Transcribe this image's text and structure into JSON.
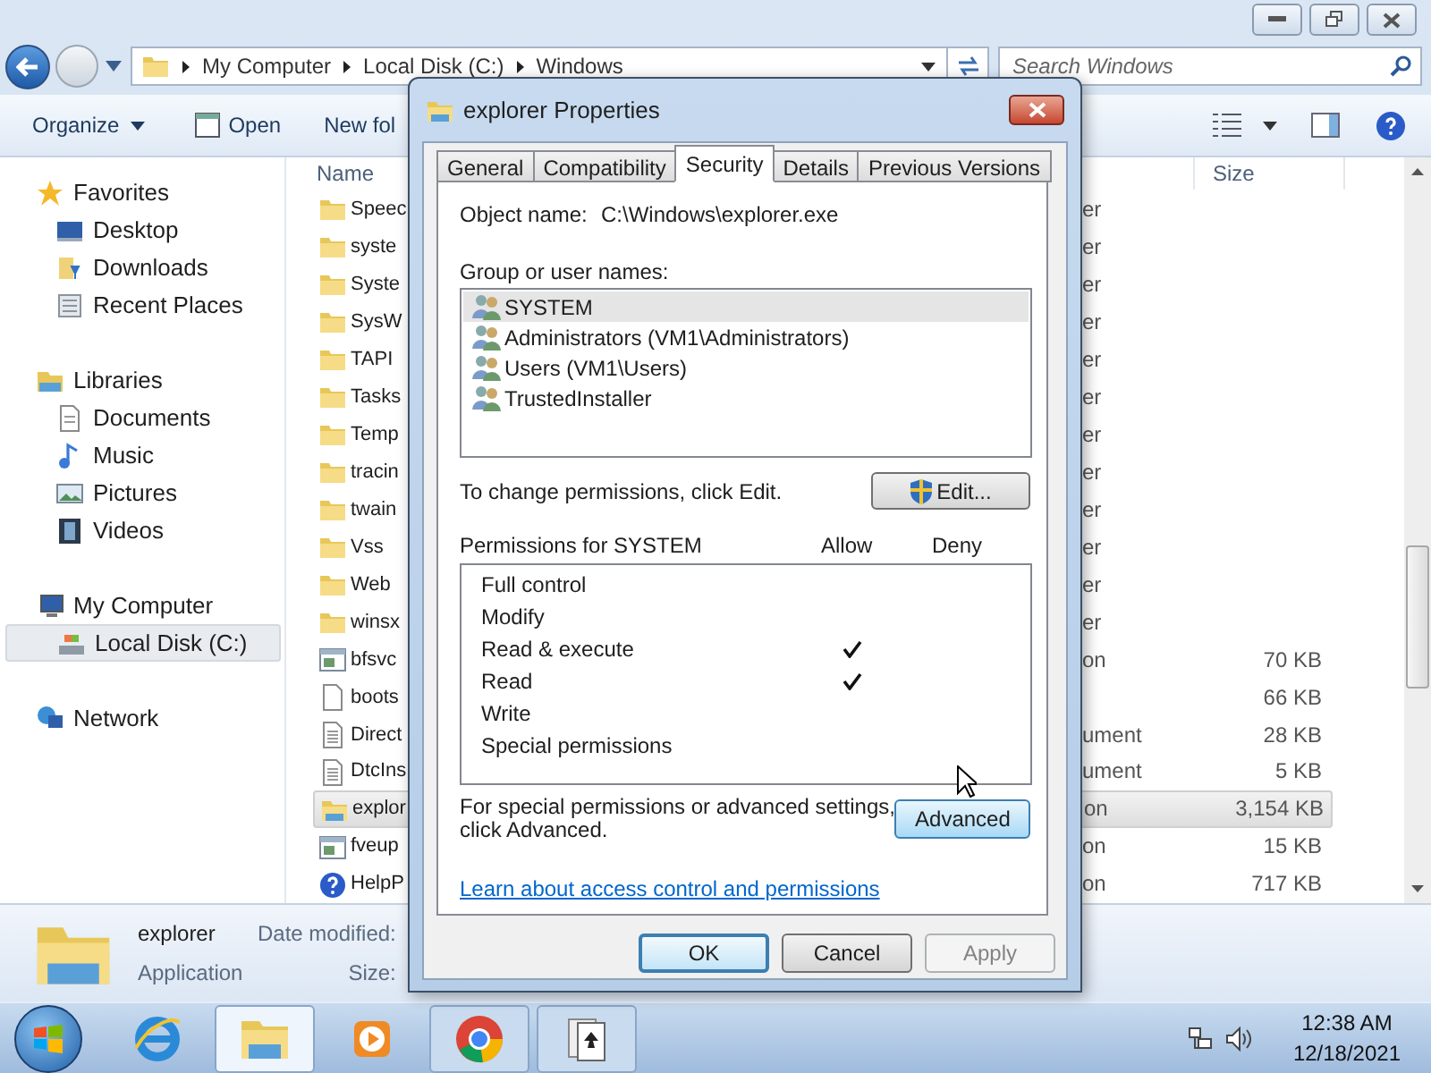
{
  "address_bar": {
    "crumbs": [
      "My Computer",
      "Local Disk (C:)",
      "Windows"
    ]
  },
  "search": {
    "placeholder": "Search Windows"
  },
  "toolbar": {
    "items": [
      {
        "label": "Organize",
        "kind": "menu"
      },
      {
        "label": "Open",
        "kind": "open"
      },
      {
        "label": "New fol",
        "kind": "plain"
      }
    ]
  },
  "nav": {
    "groups": [
      {
        "label": "Favorites",
        "kind": "star",
        "selected": false,
        "children": [
          {
            "label": "Desktop",
            "kind": "desktop",
            "selected": false
          },
          {
            "label": "Downloads",
            "kind": "downloads",
            "selected": false
          },
          {
            "label": "Recent Places",
            "kind": "recent",
            "selected": false
          }
        ]
      },
      {
        "label": "Libraries",
        "kind": "library",
        "selected": false,
        "children": [
          {
            "label": "Documents",
            "kind": "documents",
            "selected": false
          },
          {
            "label": "Music",
            "kind": "music",
            "selected": false
          },
          {
            "label": "Pictures",
            "kind": "pictures",
            "selected": false
          },
          {
            "label": "Videos",
            "kind": "videos",
            "selected": false
          }
        ]
      },
      {
        "label": "My Computer",
        "kind": "computer",
        "selected": false,
        "children": [
          {
            "label": "Local Disk (C:)",
            "kind": "disk",
            "selected": true
          }
        ]
      },
      {
        "label": "Network",
        "kind": "network",
        "selected": false
      }
    ]
  },
  "file_list": {
    "columns": [
      "Name",
      "Size"
    ],
    "rows": [
      {
        "name": "Speec",
        "type": "er",
        "kind": "folder",
        "selected": false
      },
      {
        "name": "syste",
        "type": "er",
        "kind": "folder",
        "selected": false
      },
      {
        "name": "Syste",
        "type": "er",
        "kind": "folder",
        "selected": false
      },
      {
        "name": "SysW",
        "type": "er",
        "kind": "folder",
        "selected": false
      },
      {
        "name": "TAPI",
        "type": "er",
        "kind": "folder",
        "selected": false
      },
      {
        "name": "Tasks",
        "type": "er",
        "kind": "folder",
        "selected": false
      },
      {
        "name": "Temp",
        "type": "er",
        "kind": "folder",
        "selected": false
      },
      {
        "name": "tracin",
        "type": "er",
        "kind": "folder",
        "selected": false
      },
      {
        "name": "twain",
        "type": "er",
        "kind": "folder",
        "selected": false
      },
      {
        "name": "Vss",
        "type": "er",
        "kind": "folder",
        "selected": false
      },
      {
        "name": "Web",
        "type": "er",
        "kind": "folder",
        "selected": false
      },
      {
        "name": "winsx",
        "type": "er",
        "kind": "folder",
        "selected": false
      },
      {
        "name": "bfsvc",
        "type": "on",
        "size": "70 KB",
        "kind": "program",
        "selected": false
      },
      {
        "name": "boots",
        "size": "66 KB",
        "kind": "file",
        "selected": false
      },
      {
        "name": "Direct",
        "type": "ument",
        "size": "28 KB",
        "kind": "text",
        "selected": false
      },
      {
        "name": "DtcIns",
        "type": "ument",
        "size": "5 KB",
        "kind": "text",
        "selected": false
      },
      {
        "name": "explor",
        "type": "on",
        "size": "3,154 KB",
        "kind": "explorer",
        "selected": true
      },
      {
        "name": "fveup",
        "type": "on",
        "size": "15 KB",
        "kind": "program",
        "selected": false
      },
      {
        "name": "HelpP",
        "type": "on",
        "size": "717 KB",
        "kind": "help",
        "selected": false
      }
    ]
  },
  "details_pane": {
    "name": "explorer",
    "type": "Application",
    "labels": [
      "Date modified:",
      "Size:"
    ]
  },
  "dialog": {
    "title": "explorer Properties",
    "tabs": [
      {
        "label": "General",
        "selected": false
      },
      {
        "label": "Compatibility",
        "selected": false
      },
      {
        "label": "Security",
        "selected": true
      },
      {
        "label": "Details",
        "selected": false
      },
      {
        "label": "Previous Versions",
        "selected": false
      }
    ],
    "object_label": "Object name:",
    "object_value": "C:\\Windows\\explorer.exe",
    "groups_label": "Group or user names:",
    "principals": [
      {
        "name": "SYSTEM",
        "selected": true
      },
      {
        "name": "Administrators (VM1\\Administrators)",
        "selected": false
      },
      {
        "name": "Users (VM1\\Users)",
        "selected": false
      },
      {
        "name": "TrustedInstaller",
        "selected": false
      }
    ],
    "edit_hint": "To change permissions, click Edit.",
    "edit_button": "Edit...",
    "permissions_label": "Permissions for SYSTEM",
    "allow_label": "Allow",
    "deny_label": "Deny",
    "permissions": [
      {
        "name": "Full control",
        "allow": false,
        "deny": false
      },
      {
        "name": "Modify",
        "allow": false,
        "deny": false
      },
      {
        "name": "Read & execute",
        "allow": true,
        "deny": false
      },
      {
        "name": "Read",
        "allow": true,
        "deny": false
      },
      {
        "name": "Write",
        "allow": false,
        "deny": false
      },
      {
        "name": "Special permissions",
        "allow": false,
        "deny": false
      }
    ],
    "advanced_hint": [
      "For special permissions or advanced settings,",
      "click Advanced."
    ],
    "advanced_button": "Advanced",
    "link": "Learn about access control and permissions",
    "buttons": [
      {
        "label": "OK",
        "kind": "default",
        "disabled": false
      },
      {
        "label": "Cancel",
        "kind": "normal",
        "disabled": false
      },
      {
        "label": "Apply",
        "kind": "normal",
        "disabled": true
      }
    ]
  },
  "taskbar": {
    "apps": [
      {
        "kind": "ie",
        "running": false,
        "active": false
      },
      {
        "kind": "explorer",
        "running": true,
        "active": true
      },
      {
        "kind": "media",
        "running": false,
        "active": false
      },
      {
        "kind": "chrome",
        "running": true,
        "active": false
      },
      {
        "kind": "solitaire",
        "running": true,
        "active": false
      }
    ],
    "clock": {
      "time": "12:38 AM",
      "date": "12/18/2021"
    }
  }
}
